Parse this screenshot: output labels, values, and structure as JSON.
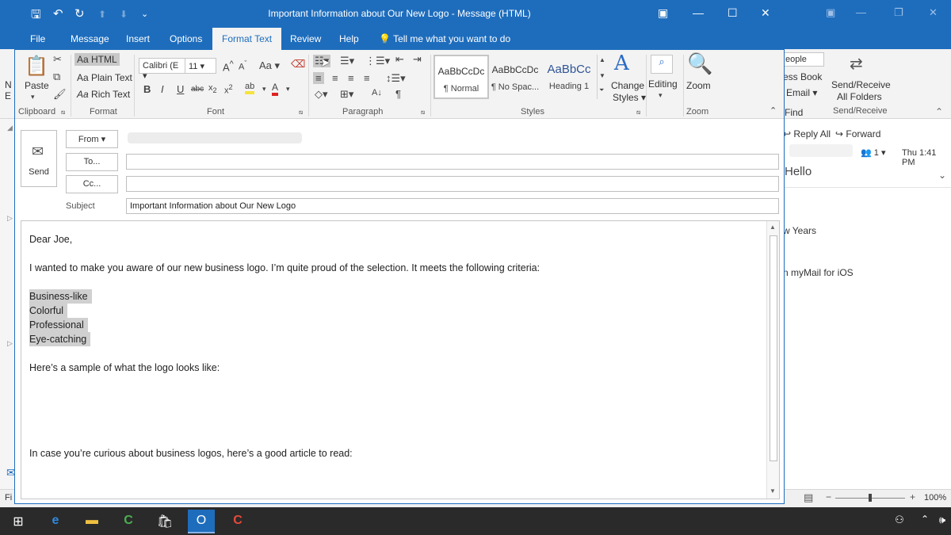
{
  "window": {
    "title": "Important Information about Our New Logo  -  Message (HTML)"
  },
  "tabs": [
    "File",
    "Message",
    "Insert",
    "Options",
    "Format Text",
    "Review",
    "Help"
  ],
  "tell_me": "Tell me what you want to do",
  "ribbon": {
    "clipboard": {
      "paste": "Paste",
      "label": "Clipboard"
    },
    "format": {
      "html": "HTML",
      "plain": "Plain Text",
      "rich": "Rich Text",
      "label": "Format"
    },
    "font": {
      "family": "Calibri (E",
      "size": "11",
      "label": "Font"
    },
    "paragraph": {
      "label": "Paragraph"
    },
    "styles": {
      "items": [
        {
          "preview": "AaBbCcDc",
          "name": "¶ Normal"
        },
        {
          "preview": "AaBbCcDc",
          "name": "¶ No Spac..."
        },
        {
          "preview": "AaBbCc",
          "name": "Heading 1"
        }
      ],
      "change": "Change",
      "change2": "Styles",
      "label": "Styles"
    },
    "editing": {
      "label": "Editing"
    },
    "zoom": {
      "btn": "Zoom",
      "label": "Zoom"
    }
  },
  "header": {
    "send": "Send",
    "from": "From",
    "to": "To...",
    "cc": "Cc...",
    "subject_label": "Subject",
    "subject_value": "Important Information about Our New Logo"
  },
  "body": {
    "greeting": "Dear Joe,",
    "line1": "I wanted to make you aware of our new business logo. I’m quite proud of the selection. It meets the following criteria:",
    "criteria": [
      "Business-like",
      "Colorful",
      "Professional",
      "Eye-catching"
    ],
    "line2": "Here’s a sample of what the logo looks like:",
    "line3": "In case you’re curious about business logos, here’s a good article to read:"
  },
  "background": {
    "people": "eople",
    "address_book": "ess Book",
    "email": "Email",
    "find": "Find",
    "send_receive": "Send/Receive",
    "all_folders": "All Folders",
    "send_receive_group": "Send/Receive",
    "reply_all": "Reply All",
    "forward": "Forward",
    "people_count": "1",
    "time": "Thu 1:41 PM",
    "hello": "Hello",
    "new_years": "w Years",
    "mymail": "n myMail for iOS",
    "zoom_pct": "100%",
    "left_n": "N",
    "left_e": "E",
    "left_fi": "Fi"
  }
}
